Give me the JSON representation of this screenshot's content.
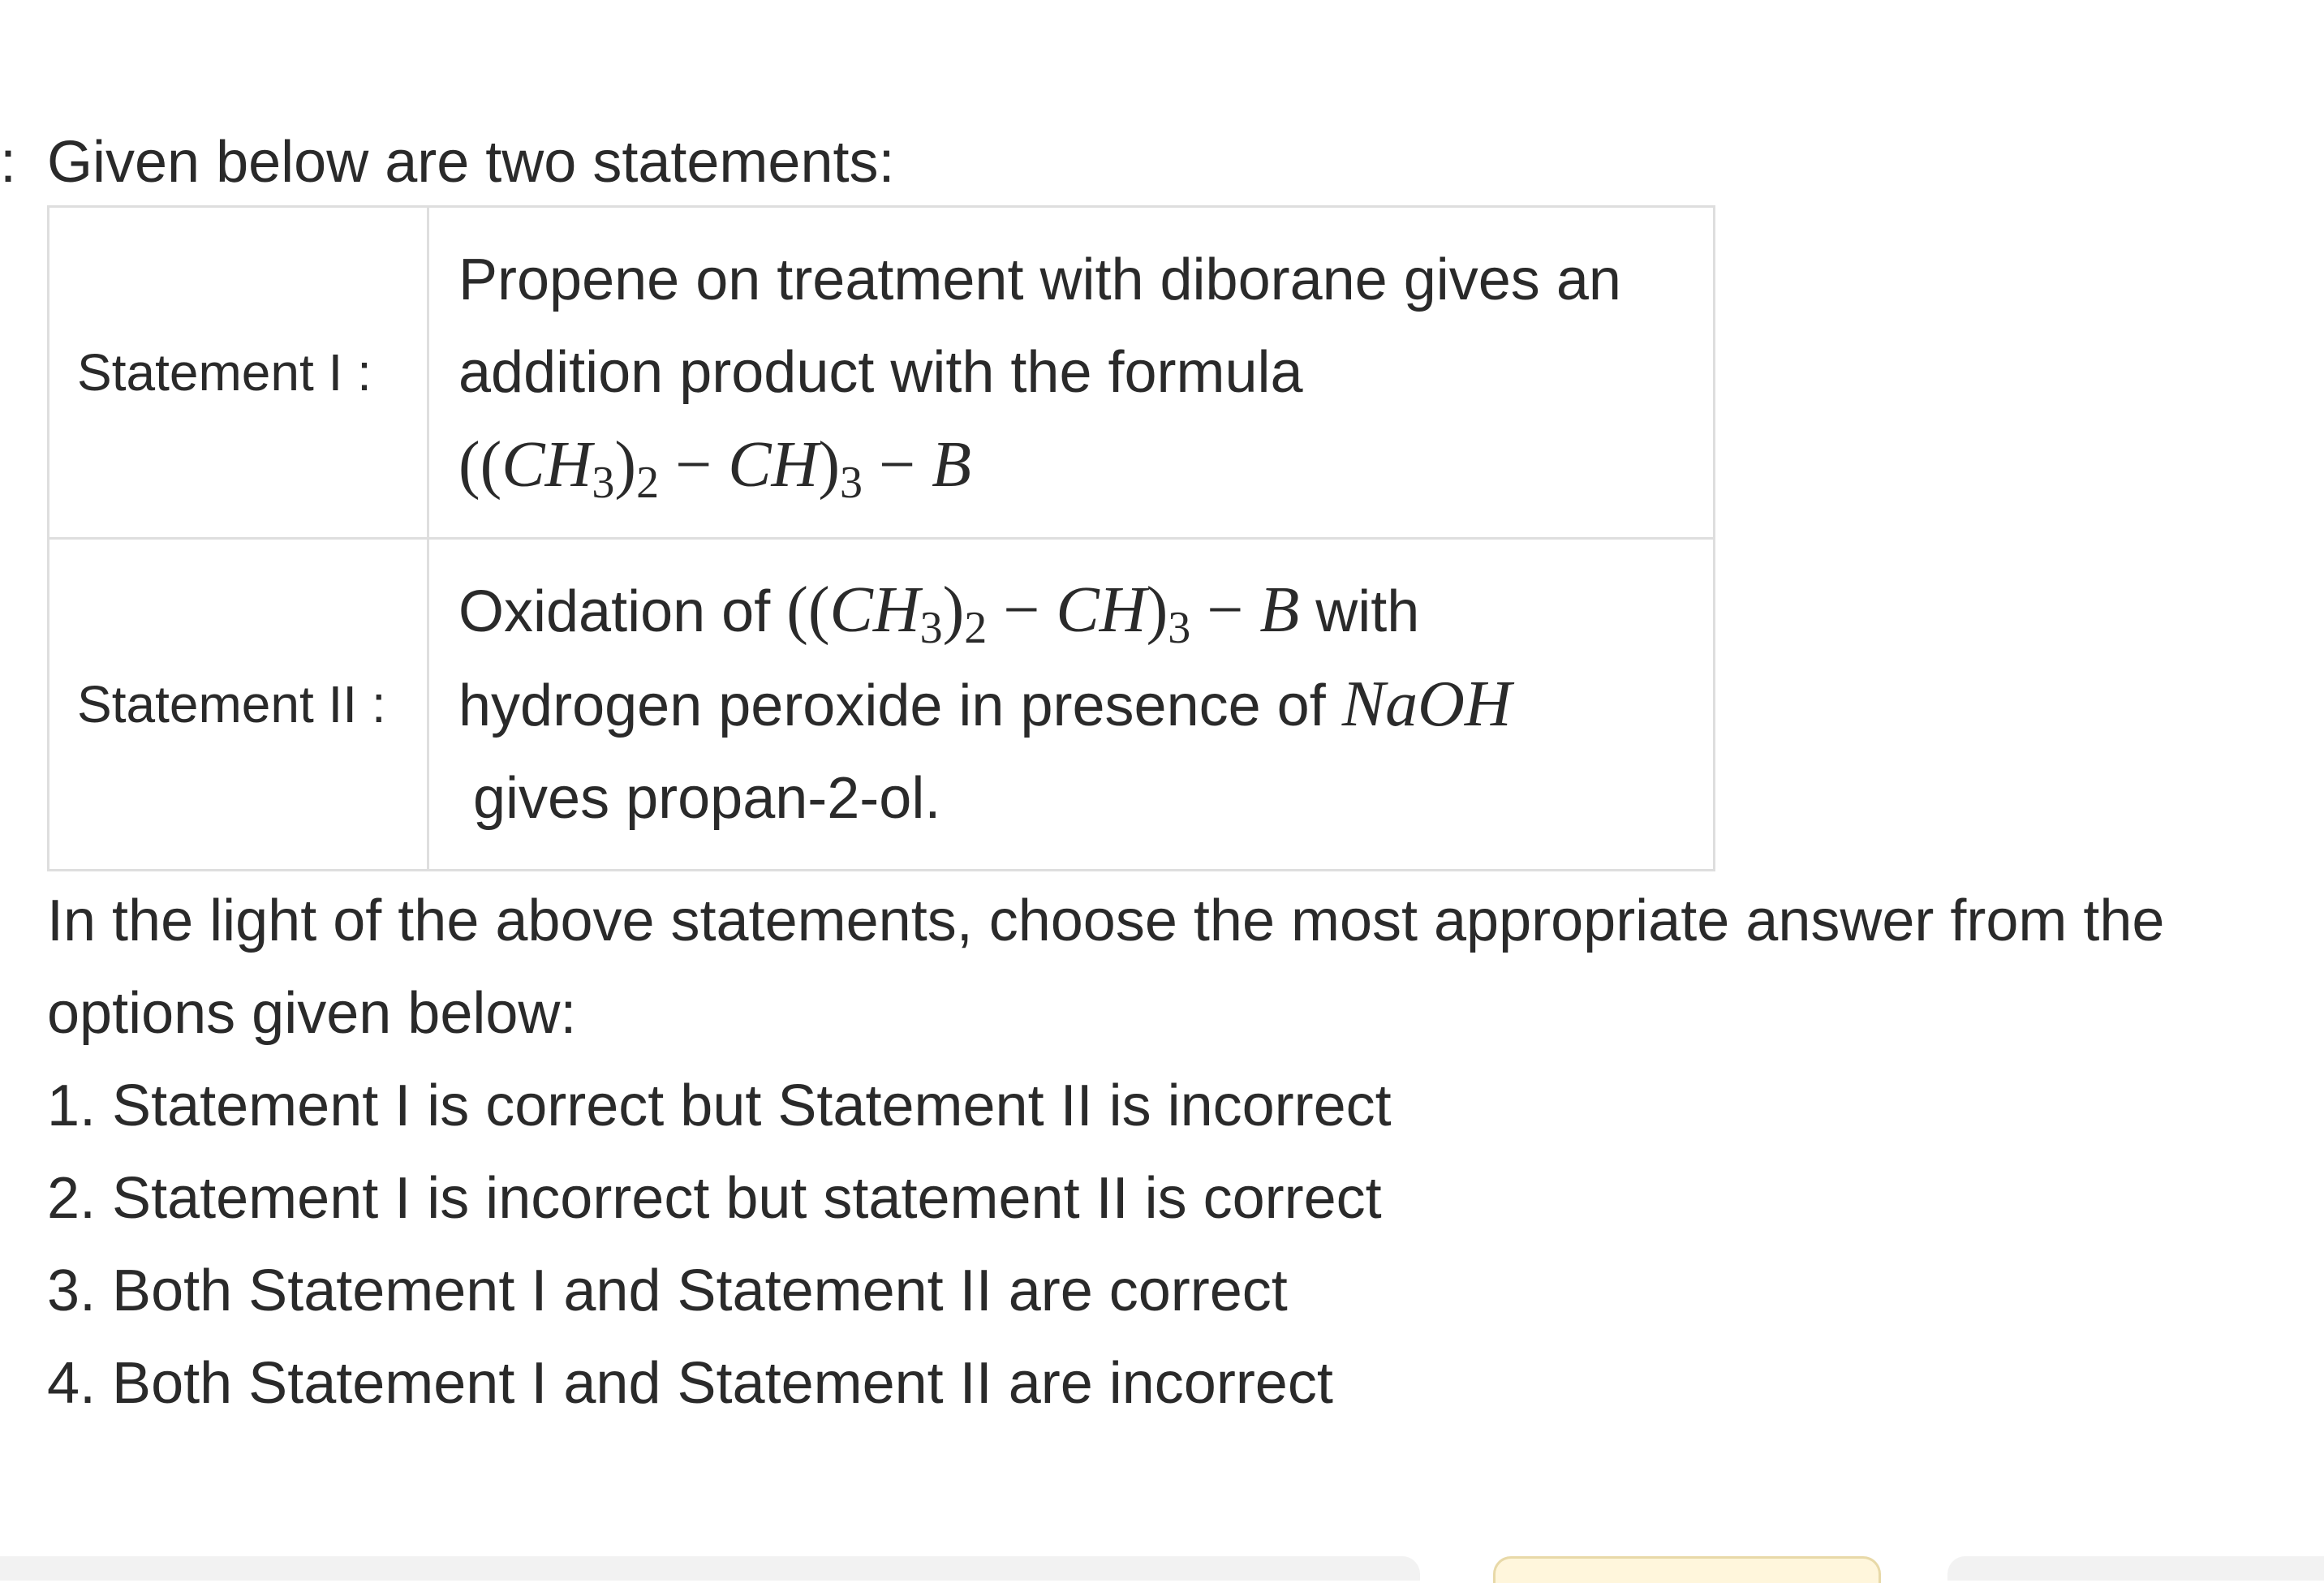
{
  "question": {
    "leading_mark": ":",
    "intro": "Given below are two statements:",
    "statements": [
      {
        "label": "Statement I :",
        "line1": "Propene on treatment with diborane gives an",
        "line2": "addition product with the formula",
        "formula": {
          "open": "((",
          "ch": "CH",
          "sub3": "3",
          "close1": ")",
          "sub2": "2",
          "minus": " − ",
          "ch2": "CH",
          "close2": ")",
          "sub3b": "3",
          "minus2": " − ",
          "b": "B"
        }
      },
      {
        "label": "Statement II :",
        "prefix": "Oxidation of ",
        "formula": {
          "open": "((",
          "ch": "CH",
          "sub3": "3",
          "close1": ")",
          "sub2": "2",
          "minus": " − ",
          "ch2": "CH",
          "close2": ")",
          "sub3b": "3",
          "minus2": " − ",
          "b": "B"
        },
        "suffix": " with",
        "line2": "hydrogen peroxide in presence of ",
        "reagent": "NaOH",
        "line3": "gives propan-2-ol."
      }
    ],
    "prompt_line1": "In the light of the above statements, choose the most appropriate answer from the",
    "prompt_line2": "options given below:",
    "options": [
      "1. Statement I is correct but Statement II is incorrect",
      "2. Statement I is incorrect but statement II is correct",
      "3. Both Statement I and Statement II are correct",
      "4. Both Statement I and Statement II are incorrect"
    ]
  },
  "colors": {
    "text": "#2a2a2a",
    "table_border": "#dedede",
    "highlight_tab": "#fff6dc",
    "tab_gray": "#f2f2f2"
  }
}
